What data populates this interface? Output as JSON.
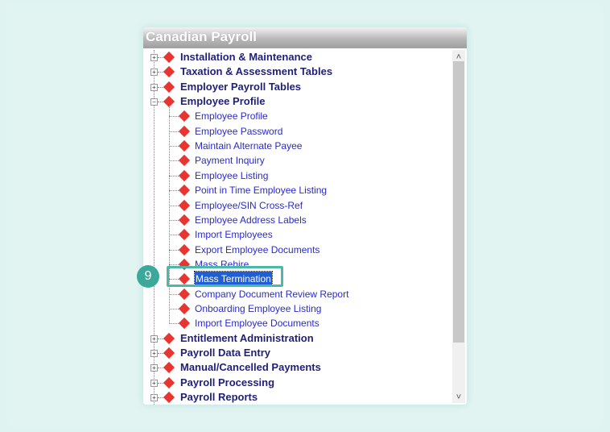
{
  "window": {
    "title": "Canadian Payroll"
  },
  "tree": {
    "top_before": [
      {
        "label": "Installation & Maintenance",
        "expanded": false
      },
      {
        "label": "Taxation & Assessment Tables",
        "expanded": false
      },
      {
        "label": "Employer Payroll Tables",
        "expanded": false
      },
      {
        "label": "Employee Profile",
        "expanded": true
      }
    ],
    "children": [
      {
        "label": "Employee Profile"
      },
      {
        "label": "Employee Password"
      },
      {
        "label": "Maintain Alternate Payee"
      },
      {
        "label": "Payment Inquiry"
      },
      {
        "label": "Employee Listing"
      },
      {
        "label": "Point in Time Employee Listing"
      },
      {
        "label": "Employee/SIN Cross-Ref"
      },
      {
        "label": "Employee Address Labels"
      },
      {
        "label": "Import Employees"
      },
      {
        "label": "Export Employee Documents"
      },
      {
        "label": "Mass Rehire"
      },
      {
        "label": "Mass Termination",
        "selected": true
      },
      {
        "label": "Company Document Review Report"
      },
      {
        "label": "Onboarding Employee Listing"
      },
      {
        "label": "Import Employee Documents"
      }
    ],
    "top_after": [
      {
        "label": "Entitlement Administration",
        "expanded": false
      },
      {
        "label": "Payroll Data Entry",
        "expanded": false
      },
      {
        "label": "Manual/Cancelled Payments",
        "expanded": false
      },
      {
        "label": "Payroll Processing",
        "expanded": false
      },
      {
        "label": "Payroll Reports",
        "expanded": false
      }
    ]
  },
  "scrollbar": {
    "up_icon": "˄",
    "down_icon": "˅",
    "position_fraction": 0.0,
    "visible_fraction": 0.85
  },
  "callout": {
    "step": "9"
  },
  "colors": {
    "accent": "#3aa89a",
    "selection": "#1e5fd6",
    "node_icon": "#e8352f"
  }
}
